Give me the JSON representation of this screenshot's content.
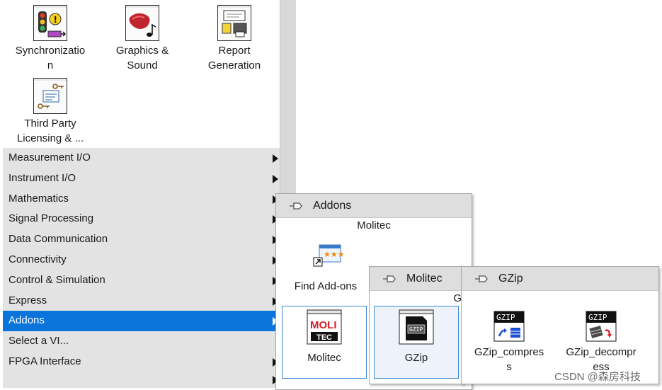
{
  "palette": {
    "icons": [
      {
        "label_line1": "Synchronizatio",
        "label_line2": "n",
        "icon": "traffic-light-icon"
      },
      {
        "label_line1": "Graphics &",
        "label_line2": "Sound",
        "icon": "graphics-sound-icon"
      },
      {
        "label_line1": "Report",
        "label_line2": "Generation",
        "icon": "report-printer-icon"
      },
      {
        "label_line1": "Third Party",
        "label_line2": "Licensing & ...",
        "icon": "license-keys-icon"
      }
    ],
    "categories": [
      {
        "label": "Measurement I/O",
        "has_submenu": true
      },
      {
        "label": "Instrument I/O",
        "has_submenu": true
      },
      {
        "label": "Mathematics",
        "has_submenu": true
      },
      {
        "label": "Signal Processing",
        "has_submenu": true
      },
      {
        "label": "Data Communication",
        "has_submenu": true
      },
      {
        "label": "Connectivity",
        "has_submenu": true
      },
      {
        "label": "Control & Simulation",
        "has_submenu": true
      },
      {
        "label": "Express",
        "has_submenu": true
      },
      {
        "label": "Addons",
        "has_submenu": true,
        "selected": true
      },
      {
        "label": "Select a VI...",
        "has_submenu": false
      },
      {
        "label": "FPGA Interface",
        "has_submenu": true
      }
    ],
    "selection_color": "#0a74da"
  },
  "addons_popup": {
    "title": "Addons",
    "subtitle": "Molitec",
    "find_addons_label": "Find Add-ons",
    "molitec_label": "Molitec",
    "molitec_logo_top": "MOLI",
    "molitec_logo_bottom": "TEC"
  },
  "molitec_popup": {
    "title": "Molitec",
    "clipped_text": "G",
    "gzip_label": "GZip",
    "gzip_icon_text": "GZIP"
  },
  "gzip_popup": {
    "title": "GZip",
    "compress_label_line1": "GZip_compres",
    "compress_label_line2": "s",
    "decompress_label_line1": "GZip_decompr",
    "decompress_label_line2": "ess",
    "icon_text": "GZIP"
  },
  "watermark": "CSDN @森房科技"
}
